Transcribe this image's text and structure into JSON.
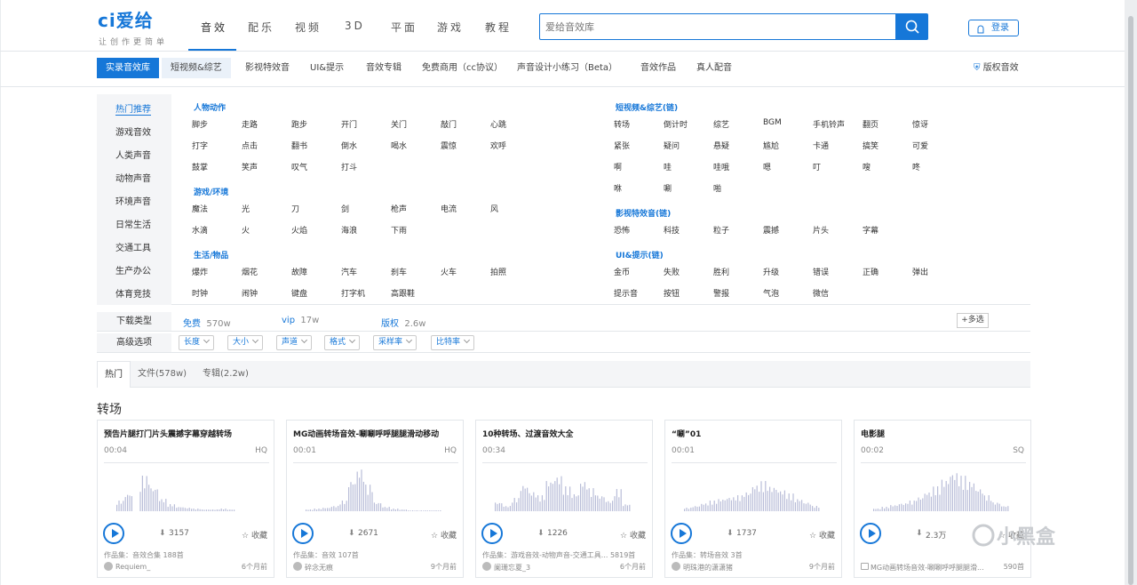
{
  "header": {
    "logo": "ci爱给",
    "slogan": "让创作更简单",
    "nav": [
      "音效",
      "配乐",
      "视频",
      "3D",
      "平面",
      "游戏",
      "教程"
    ],
    "search_placeholder": "爱给音效库",
    "login": "登录"
  },
  "subnav": {
    "tabs": [
      "实录音效库",
      "短视频&综艺",
      "影视特效音",
      "UI&提示",
      "音效专辑",
      "免费商用（cc协议）",
      "声音设计小练习（Beta）",
      "音效作品",
      "真人配音"
    ],
    "copyright": "版权音效"
  },
  "categories": {
    "side": [
      "热门推荐",
      "游戏音效",
      "人类声音",
      "动物声音",
      "环境声音",
      "日常生活",
      "交通工具",
      "生产办公",
      "体育竞技"
    ],
    "groups": [
      {
        "title": "人物动作",
        "rows": [
          [
            "脚步",
            "走路",
            "跑步",
            "开门",
            "关门",
            "敲门",
            "心跳"
          ],
          [
            "打字",
            "点击",
            "翻书",
            "倒水",
            "喝水",
            "震惊",
            "欢呼"
          ],
          [
            "鼓掌",
            "笑声",
            "叹气",
            "打斗"
          ]
        ]
      },
      {
        "title": "游戏/环境",
        "rows": [
          [
            "魔法",
            "光",
            "刀",
            "剑",
            "枪声",
            "电流",
            "风"
          ],
          [
            "水滴",
            "火",
            "火焰",
            "海浪",
            "下雨"
          ]
        ]
      },
      {
        "title": "生活/物品",
        "rows": [
          [
            "爆炸",
            "烟花",
            "故障",
            "汽车",
            "刹车",
            "火车",
            "拍照"
          ],
          [
            "时钟",
            "闹钟",
            "键盘",
            "打字机",
            "高跟鞋"
          ]
        ]
      },
      {
        "title": "短视频&综艺(链)",
        "rows": [
          [
            "转场",
            "倒计时",
            "综艺",
            "BGM",
            "手机铃声",
            "翻页",
            "惊讶"
          ],
          [
            "紧张",
            "疑问",
            "悬疑",
            "尴尬",
            "卡通",
            "搞笑",
            "可爱"
          ],
          [
            "啊",
            "哇",
            "哇哦",
            "嗯",
            "叮",
            "嗖",
            "咚"
          ],
          [
            "咻",
            "唰",
            "啪"
          ]
        ]
      },
      {
        "title": "影视特效音(链)",
        "rows": [
          [
            "恐怖",
            "科技",
            "粒子",
            "震撼",
            "片头",
            "字幕"
          ]
        ]
      },
      {
        "title": "UI&提示(链)",
        "rows": [
          [
            "金币",
            "失败",
            "胜利",
            "升级",
            "错误",
            "正确",
            "弹出"
          ],
          [
            "提示音",
            "按钮",
            "警报",
            "气泡",
            "微信"
          ]
        ]
      }
    ]
  },
  "filters": {
    "download_label": "下载类型",
    "options": [
      {
        "name": "免费",
        "count": "570w"
      },
      {
        "name": "vip",
        "count": "17w"
      },
      {
        "name": "版权",
        "count": "2.6w"
      }
    ],
    "multi": "+多选",
    "advanced_label": "高级选项",
    "dropdowns": [
      "长度",
      "大小",
      "声道",
      "格式",
      "采样率",
      "比特率"
    ]
  },
  "result_tabs": [
    "热门",
    "文件(578w)",
    "专辑(2.2w)"
  ],
  "section_title": "转场",
  "cards": [
    {
      "title": "预告片腿打门片头震撼字幕穿越转场",
      "dur": "00:04",
      "q": "HQ",
      "dl": "3157",
      "fav": "收藏",
      "coll": "作品集：音效合集 188首",
      "author": "Requiem_",
      "time": "6个月前"
    },
    {
      "title": "MG动画转场音效-唰唰呼呼腿腿滑动移动",
      "dur": "00:01",
      "q": "HQ",
      "dl": "2671",
      "fav": "收藏",
      "coll": "作品集：音效 107首",
      "author": "碎念无痕",
      "time": "9个月前"
    },
    {
      "title": "10种转场、过渡音效大全",
      "dur": "00:34",
      "q": "",
      "dl": "1226",
      "fav": "收藏",
      "coll": "作品集：游戏音效-动物声音-交通工具...  5819首",
      "author": "阑珊忘夏_3",
      "time": "6个月前"
    },
    {
      "title": "“唰”01",
      "dur": "00:01",
      "q": "",
      "dl": "1737",
      "fav": "收藏",
      "coll": "作品集：转场音效 3首",
      "author": "明珠港的潇潇猪",
      "time": "9个月前"
    },
    {
      "title": "电影腿",
      "dur": "00:02",
      "q": "SQ",
      "dl": "2.3万",
      "fav": "收藏",
      "coll": "",
      "author": "MG动画转场音效-唰唰呼呼腿腿滑...",
      "time": "590首"
    }
  ],
  "watermark": "小黑盒"
}
